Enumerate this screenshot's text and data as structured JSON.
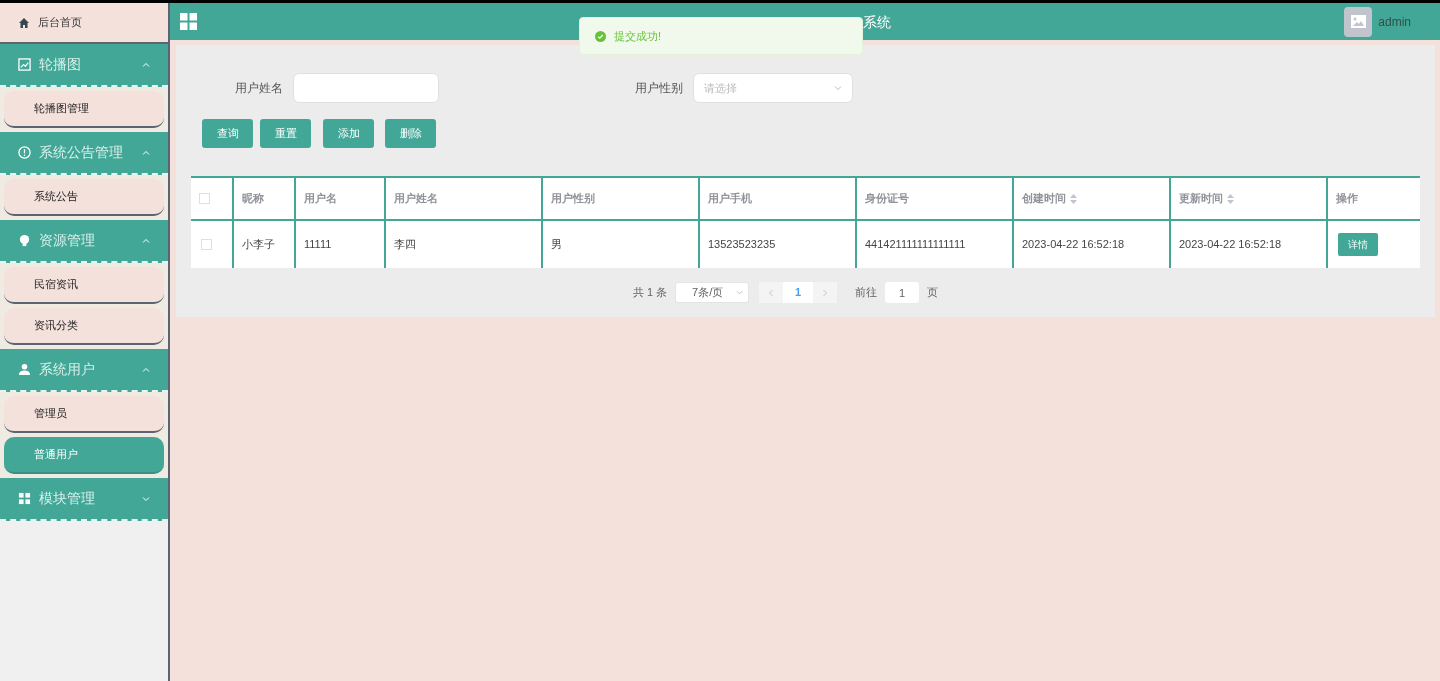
{
  "sidebar": {
    "items": [
      {
        "kind": "link",
        "label": "后台首页"
      },
      {
        "kind": "group",
        "label": "轮播图",
        "expanded": true,
        "children": [
          {
            "label": "轮播图管理",
            "selected": false
          }
        ]
      },
      {
        "kind": "group",
        "label": "系统公告管理",
        "expanded": true,
        "children": [
          {
            "label": "系统公告",
            "selected": false
          }
        ]
      },
      {
        "kind": "group",
        "label": "资源管理",
        "expanded": true,
        "children": [
          {
            "label": "民宿资讯",
            "selected": false
          },
          {
            "label": "资讯分类",
            "selected": false
          }
        ]
      },
      {
        "kind": "group",
        "label": "系统用户",
        "expanded": true,
        "children": [
          {
            "label": "管理员",
            "selected": false
          },
          {
            "label": "普通用户",
            "selected": true
          }
        ]
      },
      {
        "kind": "group",
        "label": "模块管理",
        "expanded": false
      }
    ]
  },
  "header": {
    "title": "系统",
    "user": "admin"
  },
  "toast": {
    "message": "提交成功!"
  },
  "filters": [
    {
      "label": "用户姓名",
      "kind": "input"
    },
    {
      "label": "用户性别",
      "kind": "select",
      "placeholder": "请选择"
    }
  ],
  "buttons": [
    "查询",
    "重置",
    "添加",
    "删除"
  ],
  "table": {
    "select_all": {
      "checked": false
    },
    "columns": [
      {
        "label": "昵称",
        "sortable": false
      },
      {
        "label": "用户名",
        "sortable": false
      },
      {
        "label": "用户姓名",
        "sortable": false
      },
      {
        "label": "用户性别",
        "sortable": false
      },
      {
        "label": "用户手机",
        "sortable": false
      },
      {
        "label": "身份证号",
        "sortable": false
      },
      {
        "label": "创建时间",
        "sortable": true
      },
      {
        "label": "更新时间",
        "sortable": true
      },
      {
        "label": "操作",
        "sortable": false
      }
    ],
    "rows": [
      {
        "checked": false,
        "cells": [
          "小李子",
          "11111",
          "李四",
          "男",
          "13523523235",
          "441421111111111111",
          "2023-04-22 16:52:18",
          "2023-04-22 16:52:18"
        ],
        "action": "详情"
      }
    ]
  },
  "pagination": {
    "total": "共 1 条",
    "page_size": "7条/页",
    "pages": [
      {
        "label": "1",
        "selected": true
      }
    ],
    "goto_label": "前往",
    "goto_value": "1",
    "goto_suffix": "页"
  }
}
